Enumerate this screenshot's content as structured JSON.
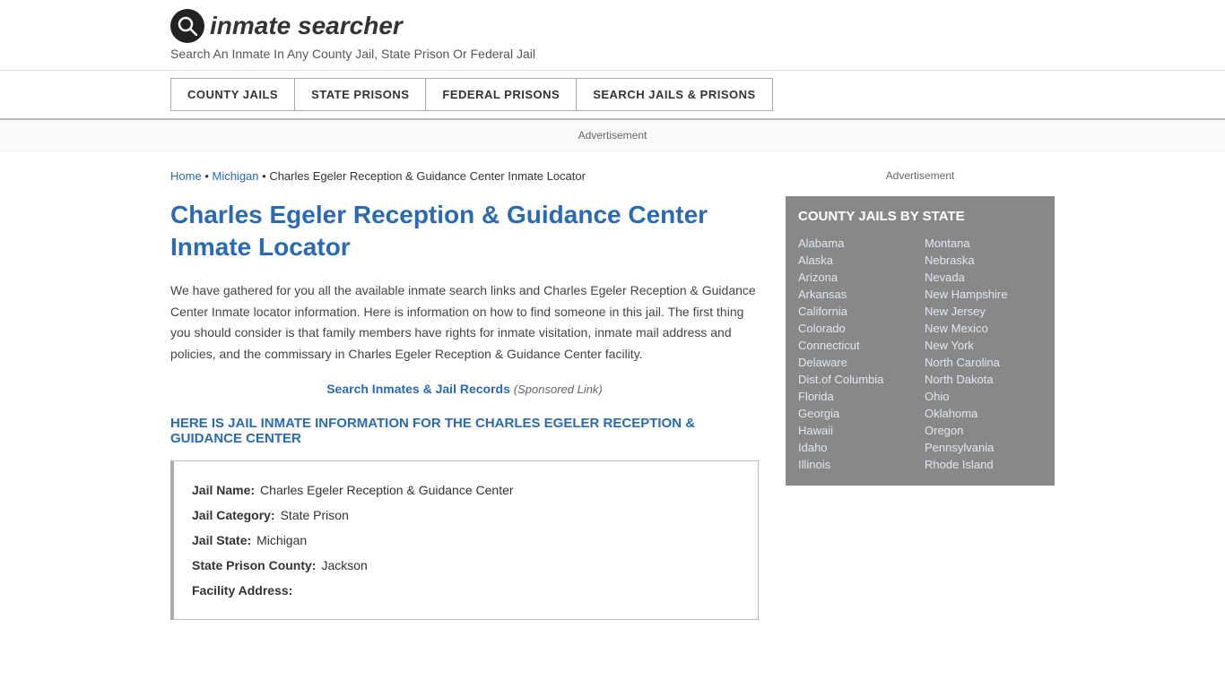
{
  "header": {
    "logo_icon": "🔍",
    "logo_text": "inmate searcher",
    "tagline": "Search An Inmate In Any County Jail, State Prison Or Federal Jail"
  },
  "nav": {
    "items": [
      {
        "label": "COUNTY JAILS",
        "id": "county-jails"
      },
      {
        "label": "STATE PRISONS",
        "id": "state-prisons"
      },
      {
        "label": "FEDERAL PRISONS",
        "id": "federal-prisons"
      },
      {
        "label": "SEARCH JAILS & PRISONS",
        "id": "search-jails"
      }
    ]
  },
  "ad_bar": {
    "label": "Advertisement"
  },
  "breadcrumb": {
    "home": "Home",
    "michigan": "Michigan",
    "current": "Charles Egeler Reception & Guidance Center Inmate Locator"
  },
  "page_title": "Charles Egeler Reception & Guidance Center Inmate Locator",
  "description": "We have gathered for you all the available inmate search links and Charles Egeler Reception & Guidance Center Inmate locator information. Here is information on how to find someone in this jail. The first thing you should consider is that family members have rights for inmate visitation, inmate mail address and policies, and the commissary in Charles Egeler Reception & Guidance Center facility.",
  "sponsored": {
    "link_text": "Search Inmates & Jail Records",
    "suffix": "(Sponsored Link)"
  },
  "section_heading": "HERE IS JAIL INMATE INFORMATION FOR THE CHARLES EGELER RECEPTION & GUIDANCE CENTER",
  "info_box": {
    "jail_name_label": "Jail Name:",
    "jail_name_value": "Charles Egeler Reception & Guidance Center",
    "jail_category_label": "Jail Category:",
    "jail_category_value": "State Prison",
    "jail_state_label": "Jail State:",
    "jail_state_value": "Michigan",
    "state_prison_county_label": "State Prison County:",
    "state_prison_county_value": "Jackson",
    "facility_address_label": "Facility Address:"
  },
  "sidebar": {
    "ad_label": "Advertisement",
    "county_jails_title": "COUNTY JAILS BY STATE",
    "states_left": [
      "Alabama",
      "Alaska",
      "Arizona",
      "Arkansas",
      "California",
      "Colorado",
      "Connecticut",
      "Delaware",
      "Dist.of Columbia",
      "Florida",
      "Georgia",
      "Hawaii",
      "Idaho",
      "Illinois"
    ],
    "states_right": [
      "Montana",
      "Nebraska",
      "Nevada",
      "New Hampshire",
      "New Jersey",
      "New Mexico",
      "New York",
      "North Carolina",
      "North Dakota",
      "Ohio",
      "Oklahoma",
      "Oregon",
      "Pennsylvania",
      "Rhode Island"
    ]
  }
}
